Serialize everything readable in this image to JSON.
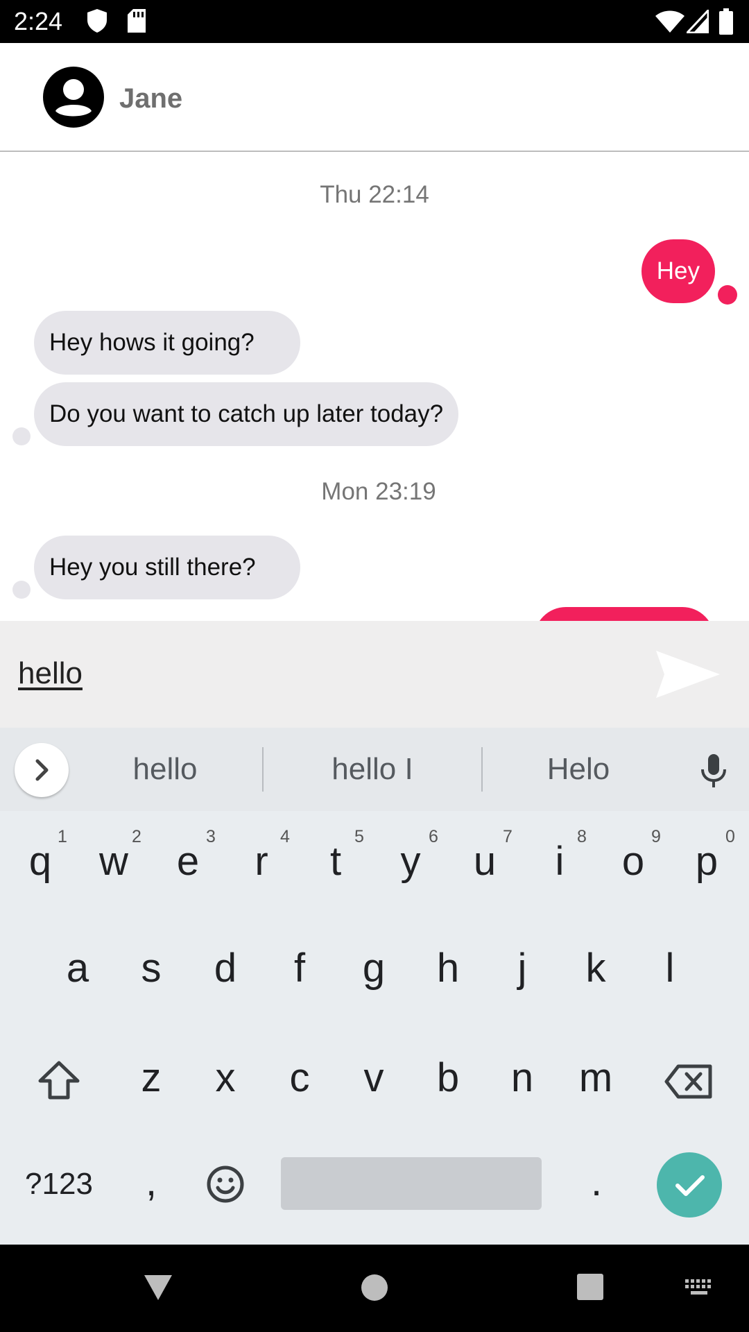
{
  "status_bar": {
    "time": "2:24"
  },
  "header": {
    "contact_name": "Jane"
  },
  "conversation": {
    "timestamps": [
      "Thu 22:14",
      "Mon 23:19"
    ],
    "messages": [
      {
        "direction": "outgoing",
        "text": "Hey"
      },
      {
        "direction": "incoming",
        "text": "Hey hows it going?"
      },
      {
        "direction": "incoming",
        "text": "Do you want to catch up later today?"
      },
      {
        "direction": "incoming",
        "text": "Hey you still there?"
      }
    ]
  },
  "compose": {
    "value": "hello"
  },
  "keyboard": {
    "suggestions": [
      "hello",
      "hello I",
      "Helo"
    ],
    "row1": [
      "q",
      "w",
      "e",
      "r",
      "t",
      "y",
      "u",
      "i",
      "o",
      "p"
    ],
    "row1_hints": [
      "1",
      "2",
      "3",
      "4",
      "5",
      "6",
      "7",
      "8",
      "9",
      "0"
    ],
    "row2": [
      "a",
      "s",
      "d",
      "f",
      "g",
      "h",
      "j",
      "k",
      "l"
    ],
    "row3": [
      "z",
      "x",
      "c",
      "v",
      "b",
      "n",
      "m"
    ],
    "symbols_label": "?123",
    "comma": ",",
    "period": "."
  },
  "colors": {
    "outgoing_bubble": "#f2205c",
    "incoming_bubble": "#e6e5ea",
    "enter_key": "#4db6ac"
  },
  "icons": {
    "status": [
      "shield-icon",
      "sd-card-icon",
      "wifi-icon",
      "cell-signal-icon",
      "battery-icon"
    ],
    "header": "account-circle-icon",
    "compose": "send-icon",
    "keyboard": [
      "chevron-right-icon",
      "microphone-icon",
      "shift-icon",
      "backspace-icon",
      "emoji-icon",
      "check-icon"
    ],
    "nav": [
      "back-icon",
      "home-icon",
      "recents-icon",
      "keyboard-switch-icon"
    ]
  }
}
